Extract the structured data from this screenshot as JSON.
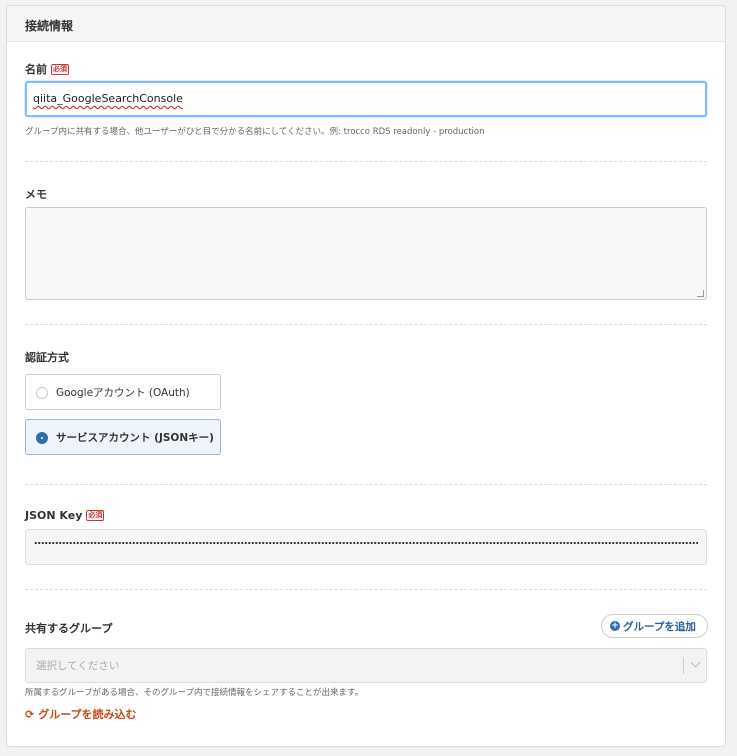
{
  "panel": {
    "title": "接続情報"
  },
  "required_badge": "必須",
  "name_field": {
    "label": "名前",
    "value": "qiita_GoogleSearchConsole",
    "help": "グループ内に共有する場合、他ユーザーがひと目で分かる名前にしてください。例: trocco RDS readonly - production"
  },
  "memo_field": {
    "label": "メモ",
    "value": ""
  },
  "auth": {
    "label": "認証方式",
    "options": [
      {
        "label": "Googleアカウント (OAuth)",
        "selected": false
      },
      {
        "label": "サービスアカウント (JSONキー)",
        "selected": true
      }
    ]
  },
  "json_key": {
    "label": "JSON Key"
  },
  "share": {
    "label": "共有するグループ",
    "add_button": "グループを追加",
    "select_placeholder": "選択してください",
    "help": "所属するグループがある場合、そのグループ内で接続情報をシェアすることが出来ます。",
    "reload": "グループを読み込む"
  },
  "colors": {
    "accent": "#2d6db0",
    "required": "#cc3333",
    "reload": "#c44a1a"
  }
}
